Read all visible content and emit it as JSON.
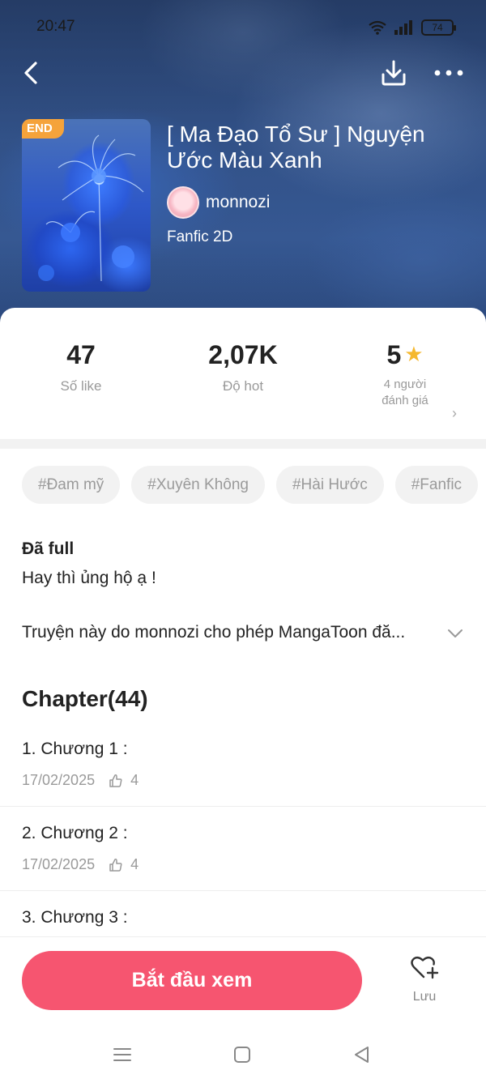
{
  "status_bar": {
    "time": "20:47",
    "battery": "74"
  },
  "book": {
    "badge": "END",
    "title": "[ Ma Đạo Tổ Sư ] Nguyện Ước Màu Xanh",
    "author": "monnozi",
    "genre": "Fanfic 2D"
  },
  "stats": {
    "likes_value": "47",
    "likes_label": "Số like",
    "hot_value": "2,07K",
    "hot_label": "Độ hot",
    "rating_value": "5",
    "rating_label_line1": "4 người",
    "rating_label_line2": "đánh giá"
  },
  "tags": [
    "#Đam mỹ",
    "#Xuyên Không",
    "#Hài Hước",
    "#Fanfic"
  ],
  "description": {
    "status": "Đã full",
    "text": "Hay thì ủng hộ ạ !",
    "permission": "Truyện này do monnozi cho phép MangaToon đă..."
  },
  "chapters": {
    "heading": "Chapter(44)",
    "items": [
      {
        "title": "1. Chương 1 :",
        "date": "17/02/2025",
        "likes": "4"
      },
      {
        "title": "2. Chương 2 :",
        "date": "17/02/2025",
        "likes": "4"
      },
      {
        "title": "3. Chương 3 :"
      }
    ]
  },
  "actions": {
    "start_label": "Bắt đầu xem",
    "save_label": "Lưu"
  },
  "colors": {
    "accent": "#f65570",
    "badge": "#f5a33b",
    "star": "#f5b82e"
  }
}
